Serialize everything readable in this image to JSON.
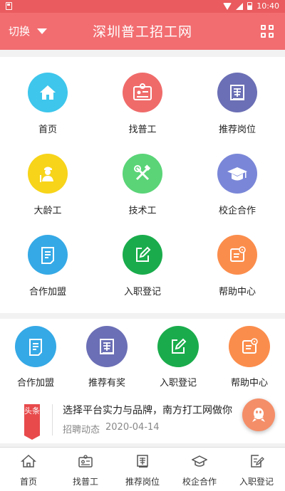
{
  "status_bar": {
    "time": "10:40"
  },
  "header": {
    "switch_label": "切换",
    "title": "深圳普工招工网",
    "scan_icon": "qr-code-icon"
  },
  "colors": {
    "header_bg": "#f26d70",
    "status_bg": "#e95b5e",
    "tag_red": "#e84a4c"
  },
  "grid": [
    {
      "label": "首页",
      "icon": "home-icon",
      "color": "#3ec6ec"
    },
    {
      "label": "找普工",
      "icon": "id-card-icon",
      "color": "#ef6b6a"
    },
    {
      "label": "推荐岗位",
      "icon": "recommend-icon",
      "color": "#6b6fb5"
    },
    {
      "label": "大龄工",
      "icon": "worker-icon",
      "color": "#f7d419"
    },
    {
      "label": "技术工",
      "icon": "tools-icon",
      "color": "#5ad477"
    },
    {
      "label": "校企合作",
      "icon": "graduation-cap-icon",
      "color": "#7a87d8"
    },
    {
      "label": "合作加盟",
      "icon": "document-icon",
      "color": "#35a9e6"
    },
    {
      "label": "入职登记",
      "icon": "edit-icon",
      "color": "#1aac4c"
    },
    {
      "label": "帮助中心",
      "icon": "help-doc-icon",
      "color": "#fb8d4c"
    }
  ],
  "quick_links": [
    {
      "label": "合作加盟",
      "icon": "document-icon",
      "color": "#35a9e6"
    },
    {
      "label": "推荐有奖",
      "icon": "recommend-icon",
      "color": "#6b6fb5"
    },
    {
      "label": "入职登记",
      "icon": "edit-icon",
      "color": "#1aac4c"
    },
    {
      "label": "帮助中心",
      "icon": "help-doc-icon",
      "color": "#fb8d4c"
    }
  ],
  "news": {
    "tag": "头条",
    "headline": "选择平台实力与品牌，南方打工网做你",
    "category": "招聘动态",
    "date": "2020-04-14"
  },
  "tabbar": [
    {
      "label": "首页",
      "icon": "home-outline-icon"
    },
    {
      "label": "找普工",
      "icon": "id-card-outline-icon"
    },
    {
      "label": "推荐岗位",
      "icon": "recommend-outline-icon"
    },
    {
      "label": "校企合作",
      "icon": "graduation-cap-outline-icon"
    },
    {
      "label": "入职登记",
      "icon": "edit-outline-icon"
    }
  ]
}
